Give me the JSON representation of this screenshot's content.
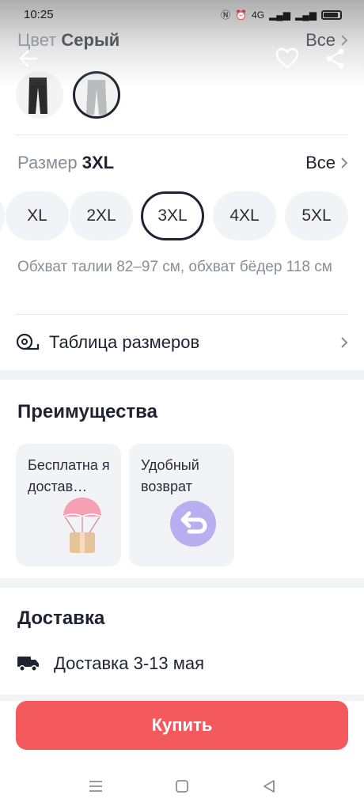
{
  "status_bar": {
    "time": "10:25",
    "network": "4G"
  },
  "color": {
    "label": "Цвет",
    "value": "Серый",
    "all_label": "Все"
  },
  "swatches": [
    {
      "name": "black-trousers",
      "color": "#2b2b2b"
    },
    {
      "name": "grey-trousers",
      "color": "#b9bbbd"
    }
  ],
  "size": {
    "label": "Размер",
    "value": "3XL",
    "all_label": "Все",
    "options": [
      "XL",
      "2XL",
      "3XL",
      "4XL",
      "5XL"
    ],
    "selected": "3XL",
    "note": "Обхват талии 82–97 см, обхват бёдер 118 см",
    "table_label": "Таблица размеров"
  },
  "benefits": {
    "title": "Преимущества",
    "items": [
      {
        "label": "Бесплатна я достав…",
        "icon": "parachute-box-icon"
      },
      {
        "label": "Удобный возврат",
        "icon": "return-arrow-icon"
      }
    ]
  },
  "delivery": {
    "title": "Доставка",
    "text": "Доставка 3-13 мая",
    "icon": "truck-icon"
  },
  "buy_button": {
    "label": "Купить"
  },
  "colors": {
    "accent": "#f4595d",
    "text": "#1f2230",
    "muted": "#8a8d99",
    "chip_bg": "#f2f3f6"
  }
}
